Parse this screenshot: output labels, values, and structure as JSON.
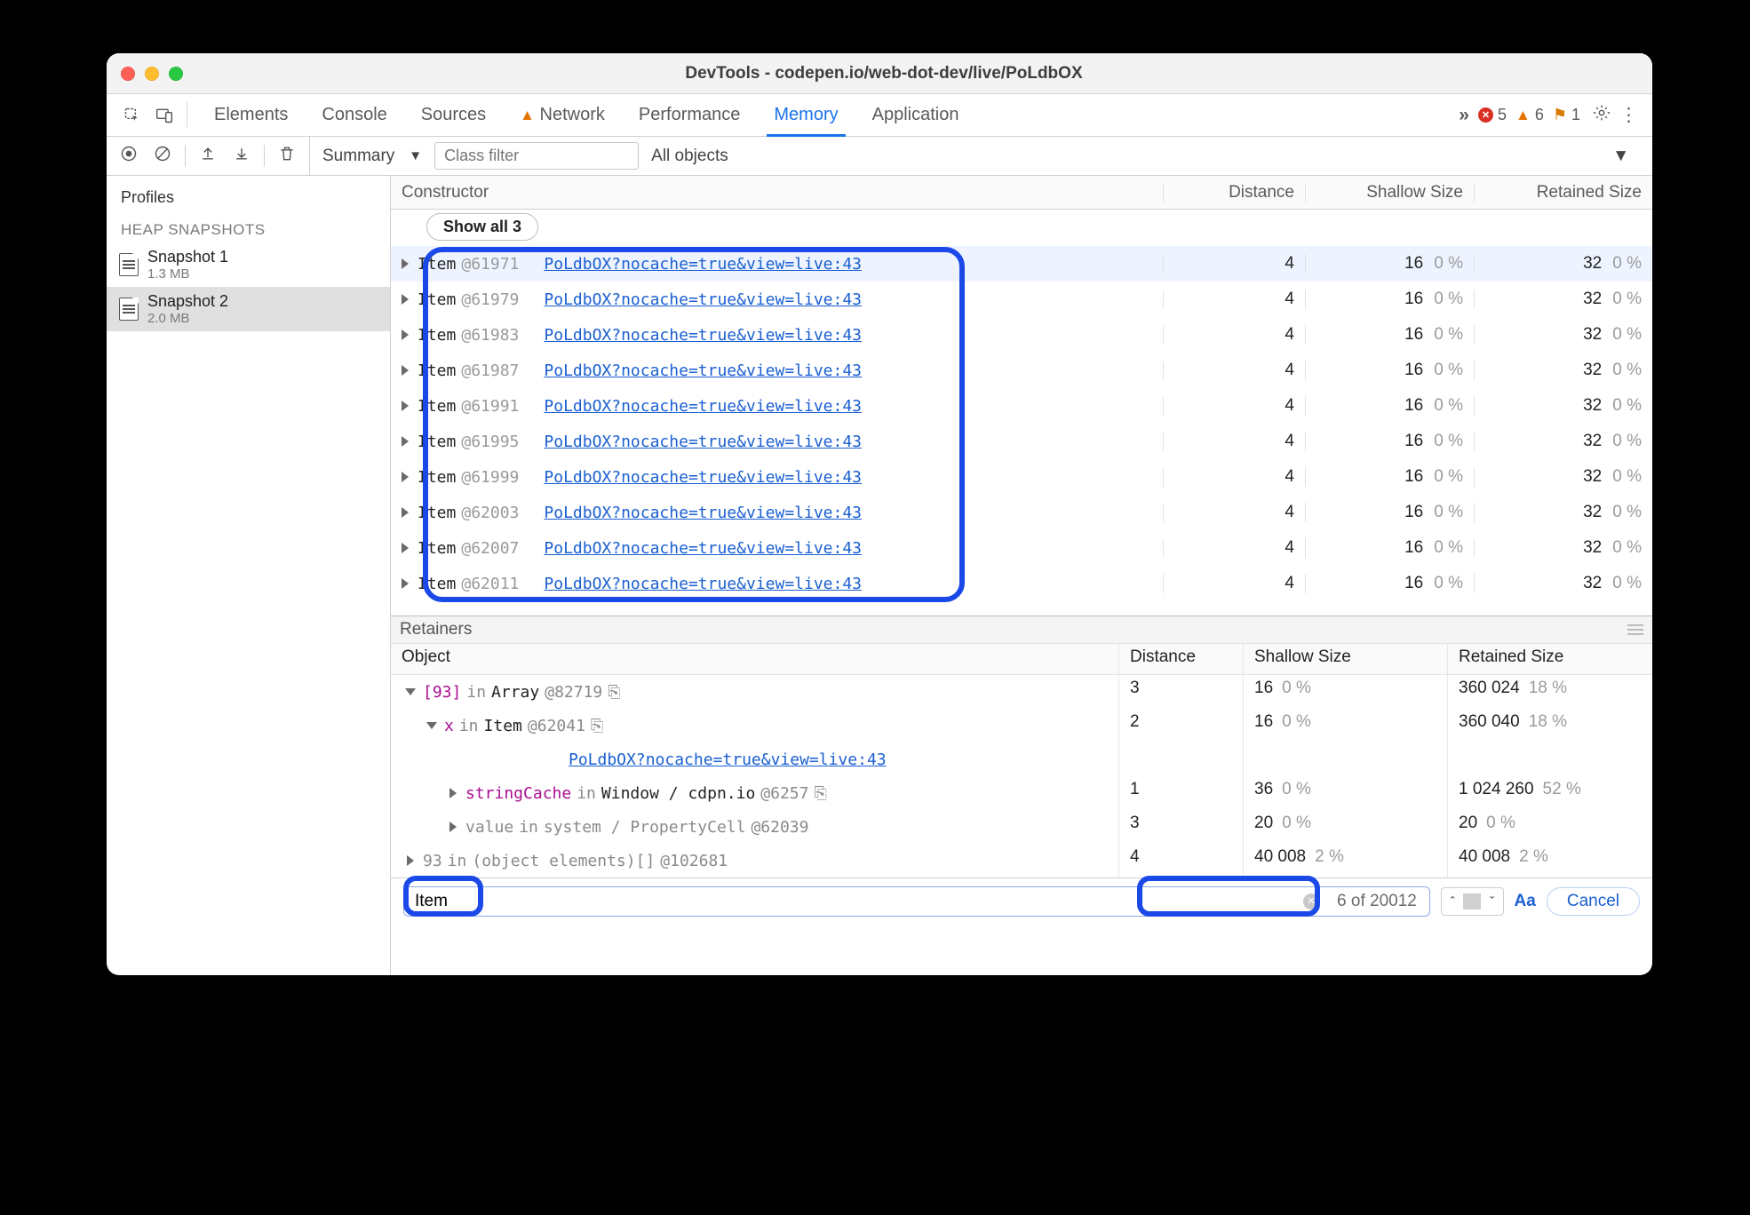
{
  "window": {
    "title": "DevTools - codepen.io/web-dot-dev/live/PoLdbOX"
  },
  "tabs": {
    "elements": "Elements",
    "console": "Console",
    "sources": "Sources",
    "network": "Network",
    "performance": "Performance",
    "memory": "Memory",
    "application": "Application",
    "more": "»",
    "errors": "5",
    "warnings": "6",
    "issues": "1"
  },
  "toolbar": {
    "view": "Summary",
    "filter_placeholder": "Class filter",
    "scope": "All objects"
  },
  "sidebar": {
    "profiles": "Profiles",
    "section": "HEAP SNAPSHOTS",
    "snapshots": [
      {
        "name": "Snapshot 1",
        "size": "1.3 MB"
      },
      {
        "name": "Snapshot 2",
        "size": "2.0 MB"
      }
    ]
  },
  "grid": {
    "col_constructor": "Constructor",
    "col_distance": "Distance",
    "col_shallow": "Shallow Size",
    "col_retained": "Retained Size",
    "show_all": "Show all 3",
    "link": "PoLdbOX?nocache=true&view=live:43",
    "rows": [
      {
        "name": "Item",
        "id": "@61971",
        "dist": "4",
        "sh": "16",
        "shp": "0 %",
        "rt": "32",
        "rtp": "0 %"
      },
      {
        "name": "Item",
        "id": "@61979",
        "dist": "4",
        "sh": "16",
        "shp": "0 %",
        "rt": "32",
        "rtp": "0 %"
      },
      {
        "name": "Item",
        "id": "@61983",
        "dist": "4",
        "sh": "16",
        "shp": "0 %",
        "rt": "32",
        "rtp": "0 %"
      },
      {
        "name": "Item",
        "id": "@61987",
        "dist": "4",
        "sh": "16",
        "shp": "0 %",
        "rt": "32",
        "rtp": "0 %"
      },
      {
        "name": "Item",
        "id": "@61991",
        "dist": "4",
        "sh": "16",
        "shp": "0 %",
        "rt": "32",
        "rtp": "0 %"
      },
      {
        "name": "Item",
        "id": "@61995",
        "dist": "4",
        "sh": "16",
        "shp": "0 %",
        "rt": "32",
        "rtp": "0 %"
      },
      {
        "name": "Item",
        "id": "@61999",
        "dist": "4",
        "sh": "16",
        "shp": "0 %",
        "rt": "32",
        "rtp": "0 %"
      },
      {
        "name": "Item",
        "id": "@62003",
        "dist": "4",
        "sh": "16",
        "shp": "0 %",
        "rt": "32",
        "rtp": "0 %"
      },
      {
        "name": "Item",
        "id": "@62007",
        "dist": "4",
        "sh": "16",
        "shp": "0 %",
        "rt": "32",
        "rtp": "0 %"
      },
      {
        "name": "Item",
        "id": "@62011",
        "dist": "4",
        "sh": "16",
        "shp": "0 %",
        "rt": "32",
        "rtp": "0 %"
      }
    ]
  },
  "retainers": {
    "title": "Retainers",
    "col_object": "Object",
    "col_distance": "Distance",
    "col_shallow": "Shallow Size",
    "col_retained": "Retained Size",
    "row1_idx": "[93]",
    "row1_in": "in",
    "row1_type": "Array",
    "row1_id": "@82719",
    "row1_dist": "3",
    "row1_sh": "16",
    "row1_shp": "0 %",
    "row1_rt": "360 024",
    "row1_rtp": "18 %",
    "row2_prop": "x",
    "row2_in": "in",
    "row2_type": "Item",
    "row2_id": "@62041",
    "row2_dist": "2",
    "row2_sh": "16",
    "row2_shp": "0 %",
    "row2_rt": "360 040",
    "row2_rtp": "18 %",
    "row2_link": "PoLdbOX?nocache=true&view=live:43",
    "row3_prop": "stringCache",
    "row3_in": "in",
    "row3_type": "Window / cdpn.io",
    "row3_id": "@6257",
    "row3_dist": "1",
    "row3_sh": "36",
    "row3_shp": "0 %",
    "row3_rt": "1 024 260",
    "row3_rtp": "52 %",
    "row4_prop": "value",
    "row4_in": "in",
    "row4_type": "system / PropertyCell",
    "row4_id": "@62039",
    "row4_dist": "3",
    "row4_sh": "20",
    "row4_shp": "0 %",
    "row4_rt": "20",
    "row4_rtp": "0 %",
    "row5_idx": "93",
    "row5_in": "in",
    "row5_type": "(object elements)[]",
    "row5_id": "@102681",
    "row5_dist": "4",
    "row5_sh": "40 008",
    "row5_shp": "2 %",
    "row5_rt": "40 008",
    "row5_rtp": "2 %"
  },
  "search": {
    "value": "Item",
    "count": "6 of 20012",
    "aa": "Aa",
    "cancel": "Cancel"
  }
}
